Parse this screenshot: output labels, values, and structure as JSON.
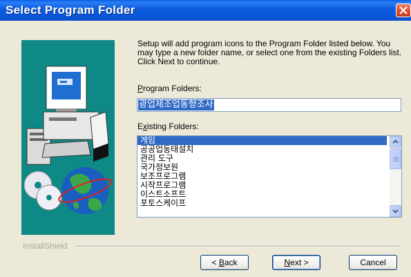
{
  "title": "Select Program Folder",
  "intro_text": "Setup will add program icons to the Program Folder listed below. You may type a new folder name, or select one from the existing Folders list.  Click Next to continue.",
  "program_folders": {
    "label_underlined": "P",
    "label_rest": "rogram Folders:",
    "value": "광업제조업동향조사"
  },
  "existing_folders": {
    "label_first": "E",
    "label_underlined": "x",
    "label_rest": "isting Folders:",
    "items": [
      "게임",
      "공공업동태설치",
      "관리 도구",
      "국가정보원",
      "보조프로그램",
      "시작프로그램",
      "이스트소프트",
      "포토스케이프"
    ],
    "selected_index": 0
  },
  "installshield_label": "InstallShield",
  "buttons": {
    "back_prefix": "< ",
    "back_underlined": "B",
    "back_rest": "ack",
    "next_underlined": "N",
    "next_rest": "ext >",
    "cancel": "Cancel"
  },
  "colors": {
    "titlebar": "#0b55d8",
    "selection": "#316ac5",
    "art_background": "#0e8986",
    "dialog": "#ece9d8"
  }
}
